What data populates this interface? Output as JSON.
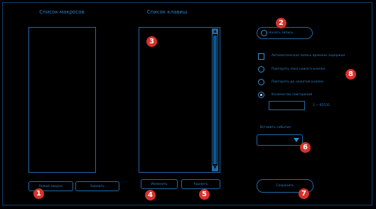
{
  "macro_list": {
    "title": "Список макросов",
    "new_button": "Новый макрос",
    "delete_button": "Удалить"
  },
  "key_list": {
    "title": "Список клавиш",
    "change_button": "Изменить",
    "delete_button": "Удалить",
    "scroll_up": "▲",
    "scroll_down": "▼"
  },
  "record_button": "Начать запись",
  "options": {
    "auto_delay": "Автоматическая запись времени задержки",
    "repeat_while_held": "Повторять пока нажата кнопка",
    "repeat_until_pressed": "Повторять до нажатия кнопки",
    "repeat_count": "Количество повторений",
    "repeat_range": "1 ~ 65535",
    "repeat_count_value": "",
    "selected": "repeat_count"
  },
  "insert_event": {
    "label": "Вставить событие",
    "value": ""
  },
  "save_button": "Сохранить",
  "markers": [
    "1",
    "2",
    "3",
    "4",
    "5",
    "6",
    "7",
    "8"
  ],
  "colors": {
    "accent": "#1f6aa8",
    "text": "#2a7fc4",
    "marker": "#d6322a",
    "background": "#000000"
  }
}
